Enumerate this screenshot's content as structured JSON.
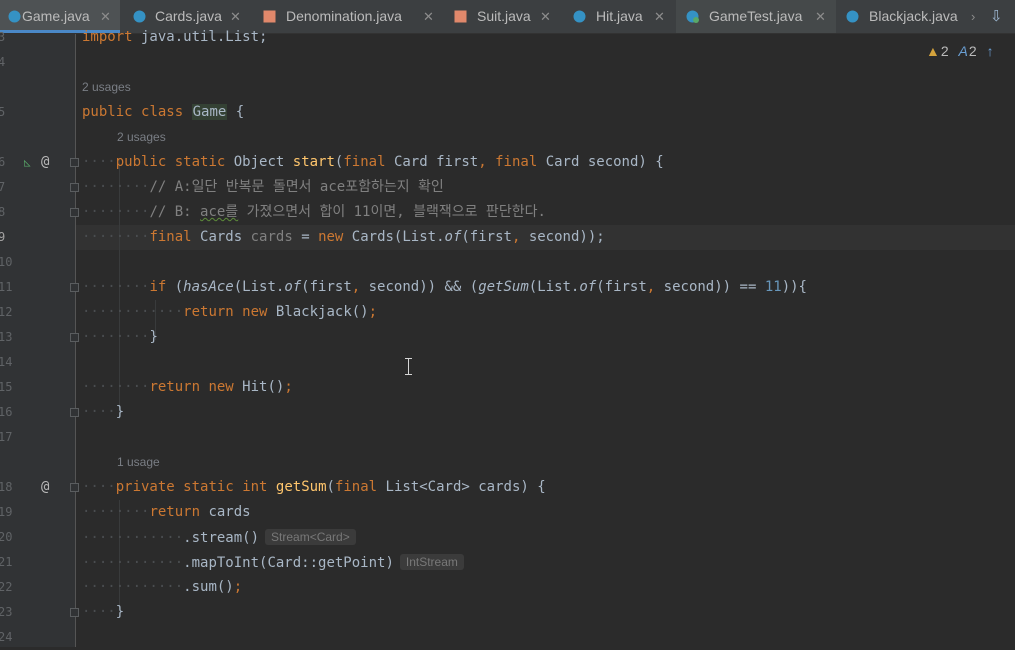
{
  "tabs": [
    {
      "name": "Game.java",
      "icon": "java-class-icon",
      "active": true
    },
    {
      "name": "Cards.java",
      "icon": "java-class-icon"
    },
    {
      "name": "Denomination.java",
      "icon": "enum-icon"
    },
    {
      "name": "Suit.java",
      "icon": "enum-icon"
    },
    {
      "name": "Hit.java",
      "icon": "java-class-icon"
    },
    {
      "name": "GameTest.java",
      "icon": "test-class-icon"
    },
    {
      "name": "Blackjack.java",
      "icon": "java-class-icon"
    }
  ],
  "tabs_overflow": "›",
  "tabs_recent": "⇩",
  "inspections": {
    "warnings": "2",
    "typos": "2"
  },
  "line_numbers": [
    "3",
    "4",
    "5",
    "6",
    "7",
    "8",
    "9",
    "10",
    "11",
    "12",
    "13",
    "14",
    "15",
    "16",
    "17",
    "18",
    "19",
    "20",
    "21",
    "22",
    "23",
    "24"
  ],
  "current_line": "9",
  "usages": {
    "class": "2 usages",
    "start": "2 usages",
    "getSum": "1 usage"
  },
  "code": {
    "l3a": "import",
    "l3b": " java.util.List;",
    "l5_public": "public",
    "l5_class": "class",
    "l5_name": "Game",
    "l5_brace": " {",
    "l6_public": "public",
    "l6_static": "static",
    "l6_ret": "Object",
    "l6_name": "start",
    "l6_open": "(",
    "l6_final1": "final",
    "l6_p1": " Card first",
    "l6_comma": ",",
    "l6_final2": "final",
    "l6_p2": " Card second) {",
    "l7": "// A:일단 반복문 돌면서 ace포함하는지 확인",
    "l8a": "// B: ",
    "l8b": "ace를",
    "l8c": " 가졌으면서 합이 11이면, 블랙잭으로 판단한다.",
    "l9_final": "final",
    "l9_type": " Cards ",
    "l9_var": "cards",
    "l9_eq": " = ",
    "l9_new": "new",
    "l9_ctor": " Cards(List.",
    "l9_of": "of",
    "l9_args1": "(first",
    "l9_comma": ",",
    "l9_args2": " second));",
    "l11_if": "if",
    "l11_a": " (",
    "l11_hasAce": "hasAce",
    "l11_b": "(List.",
    "l11_of1": "of",
    "l11_c": "(first",
    "l11_comma1": ",",
    "l11_d": " second)) ",
    "l11_and": "&&",
    "l11_e": " (",
    "l11_getSum": "getSum",
    "l11_f": "(List.",
    "l11_of2": "of",
    "l11_g": "(first",
    "l11_comma2": ",",
    "l11_h": " second)) ",
    "l11_eq": "==",
    "l11_num": " 11",
    "l11_i": ")){",
    "l12_return": "return",
    "l12_new": "new",
    "l12_rest": " Blackjack()",
    "l12_semi": ";",
    "l13": "}",
    "l15_return": "return",
    "l15_new": "new",
    "l15_rest": " Hit()",
    "l15_semi": ";",
    "l16": "}",
    "l18_private": "private",
    "l18_static": "static",
    "l18_int": "int",
    "l18_name": "getSum",
    "l18_open": "(",
    "l18_final": "final",
    "l18_rest": " List<Card> cards) {",
    "l19_return": "return",
    "l19_rest": " cards",
    "l20": ".stream()",
    "l20_hint": "Stream<Card>",
    "l21": ".mapToInt(Card::getPoint)",
    "l21_hint": "IntStream",
    "l22": ".sum()",
    "l22_semi": ";",
    "l23": "}"
  }
}
